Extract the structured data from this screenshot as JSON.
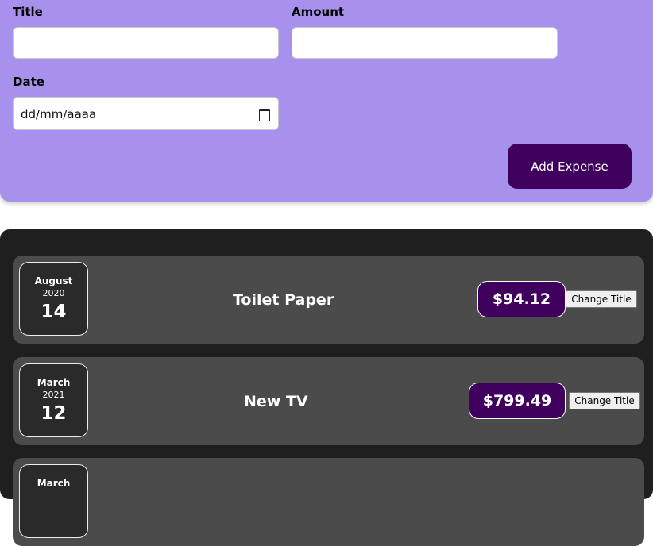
{
  "form": {
    "title_label": "Title",
    "title_value": "",
    "amount_label": "Amount",
    "amount_value": "",
    "date_label": "Date",
    "date_placeholder": "dd/mm/aaaa",
    "submit_label": "Add Expense"
  },
  "expenses": [
    {
      "month": "August",
      "year": "2020",
      "day": "14",
      "title": "Toilet Paper",
      "amount": "$94.12",
      "change_label": "Change Title"
    },
    {
      "month": "March",
      "year": "2021",
      "day": "12",
      "title": "New TV",
      "amount": "$799.49",
      "change_label": "Change Title"
    },
    {
      "month": "March",
      "year": "",
      "day": "",
      "title": "",
      "amount": "",
      "change_label": ""
    }
  ],
  "colors": {
    "form_bg": "#a891ec",
    "accent": "#40005d",
    "list_bg": "#1f1f1f",
    "item_bg": "#4b4b4b"
  }
}
